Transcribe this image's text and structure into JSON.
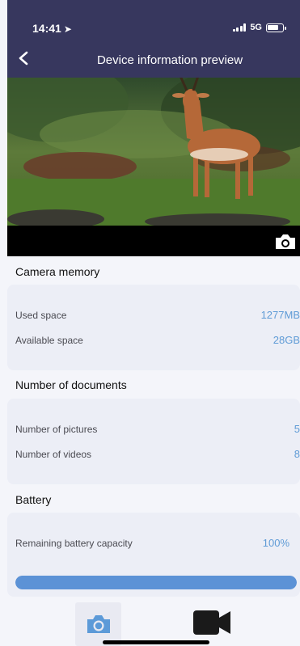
{
  "status_bar": {
    "time": "14:41",
    "network": "5G",
    "location_icon": "navigation-arrow-icon",
    "signal_icon": "signal-bars-icon",
    "battery_icon": "battery-icon"
  },
  "header": {
    "title": "Device information preview",
    "back_icon": "chevron-left-icon"
  },
  "preview": {
    "image": "antelope standing in grassy field",
    "snapshot_icon": "camera-icon"
  },
  "memory": {
    "title": "Camera memory",
    "used_label": "Used space",
    "used_value": "1277MB",
    "available_label": "Available space",
    "available_value": "28GB"
  },
  "documents": {
    "title": "Number of documents",
    "pictures_label": "Number of pictures",
    "pictures_value": "5",
    "videos_label": "Number of videos",
    "videos_value": "8"
  },
  "battery": {
    "title": "Battery",
    "remaining_label": "Remaining battery capacity",
    "remaining_value": "100%",
    "level": 1.0
  },
  "bottom_tabs": {
    "photo_icon": "camera-icon",
    "video_icon": "video-camera-icon"
  },
  "colors": {
    "header_bg": "#37375e",
    "accent": "#5f9bd6",
    "progress_fill": "#5c92d6"
  }
}
